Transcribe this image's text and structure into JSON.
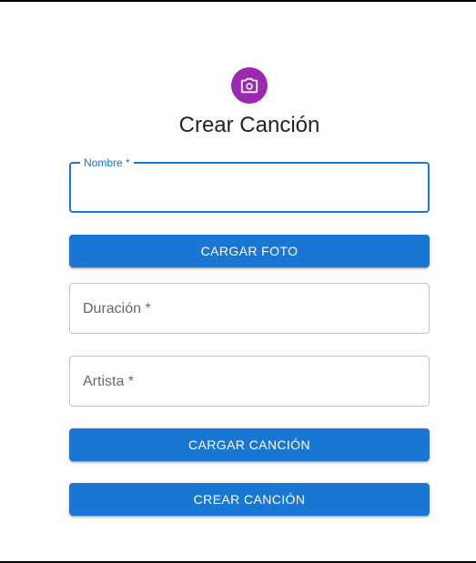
{
  "page": {
    "title": "Crear Canción",
    "avatar_icon": "camera-icon",
    "avatar_color": "#9c27b0",
    "accent_color": "#1976d2"
  },
  "form": {
    "nombre": {
      "label": "Nombre *",
      "value": ""
    },
    "duracion": {
      "label": "Duración *",
      "value": ""
    },
    "artista": {
      "label": "Artista *",
      "value": ""
    },
    "upload_photo_label": "CARGAR FOTO",
    "upload_song_label": "CARGAR CANCIÓN",
    "submit_label": "CREAR CANCIÓN"
  }
}
